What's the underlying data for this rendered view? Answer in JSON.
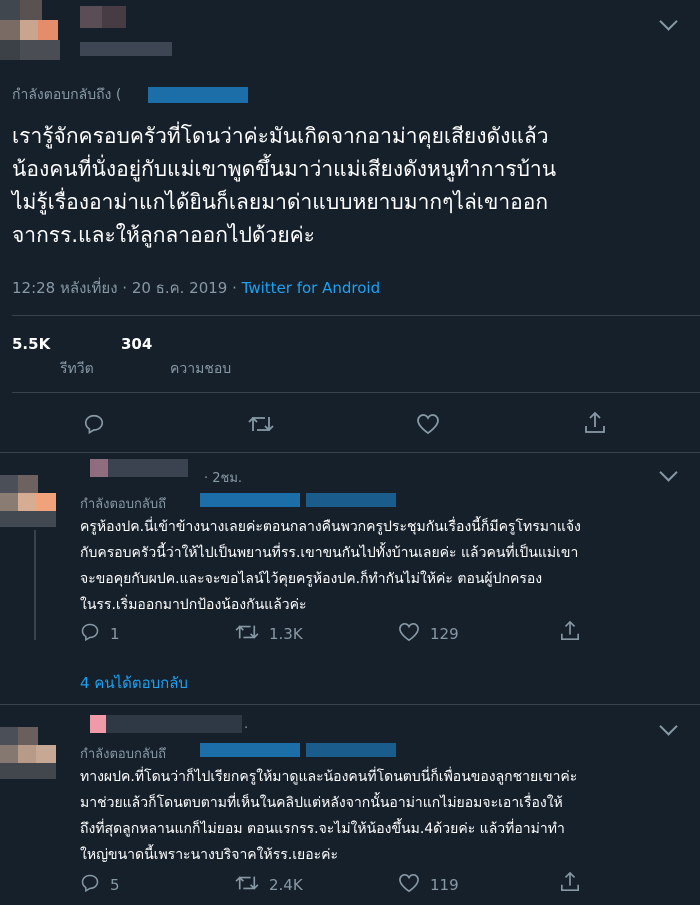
{
  "main_tweet": {
    "replying_to": "กำลังตอบกลับถึง (",
    "lines": [
      "เรารู้จักครอบครัวที่โดนว่าค่ะมันเกิดจากอาม่าคุยเสียงดังแล้ว",
      "น้องคนที่นั่งอยู่กับแม่เขาพูดขึ้นมาว่าแม่เสียงดังหนูทำการบ้าน",
      "ไม่รู้เรื่องอาม่าแกได้ยินก็เลยมาด่าแบบหยาบมากๆไล่เขาออก",
      "จากรร.และให้ลูกลาออกไปด้วยค่ะ"
    ],
    "timestamp": "12:28 หลังเที่ยง · 20 ธ.ค. 2019 · ",
    "source": "Twitter for Android",
    "retweets_count": "5.5K",
    "retweets_label": "รีทวีต",
    "likes_count": "304",
    "likes_label": "ความชอบ"
  },
  "replies": [
    {
      "time": "· 2ชม.",
      "replying_to": "กำลังตอบกลับถึ",
      "lines": [
        "ครูห้องปค.นี่เข้าข้างนางเลยค่ะตอนกลางคืนพวกครูประชุมกันเรื่องนี้ก็มีครูโทรมาแจ้ง",
        "กับครอบครัวนี้ว่าให้ไปเป็นพยานที่รร.เขาขนกันไปทั้งบ้านเลยค่ะ แล้วคนที่เป็นแม่เขา",
        "จะขอคุยกับผปค.และจะขอไลน์ไว้คุยครูห้องปค.ก็ทำกันไม่ให้ค่ะ ตอนผู้ปกครอง",
        "ในรร.เริ่มออกมาปกป้องน้องกันแล้วค่ะ"
      ],
      "reply_count": "1",
      "retweet_count": "1.3K",
      "like_count": "129",
      "show_replies": "4 คนได้ตอบกลับ"
    },
    {
      "time": ".",
      "replying_to": "กำลังตอบกลับถึ",
      "lines": [
        "ทางผปค.ที่โดนว่าก็ไปเรียกครูให้มาดูและน้องคนที่โดนตบนี่ก็เพื่อนของลูกชายเขาค่ะ",
        "มาช่วยแล้วก็โดนตบตามที่เห็นในคลิปแต่หลังจากนั้นอาม่าแกไม่ยอมจะเอาเรื่องให้",
        "ถึงที่สุดลูกหลานแกก็ไม่ยอม ตอนแรกรร.จะไม่ให้น้องขึ้นม.4ด้วยค่ะ แล้วที่อาม่าทำ",
        "ใหญ่ขนาดนี้เพราะนางบริจาคให้รร.เยอะค่ะ"
      ],
      "reply_count": "5",
      "retweet_count": "2.4K",
      "like_count": "119"
    }
  ],
  "icons": [
    "chevron-down-icon",
    "reply-icon",
    "retweet-icon",
    "like-icon",
    "share-icon"
  ],
  "colors": {
    "background": "#15202b",
    "text": "#ffffff",
    "muted": "#8899a6",
    "link": "#1da1f2",
    "divider": "#38444d"
  }
}
